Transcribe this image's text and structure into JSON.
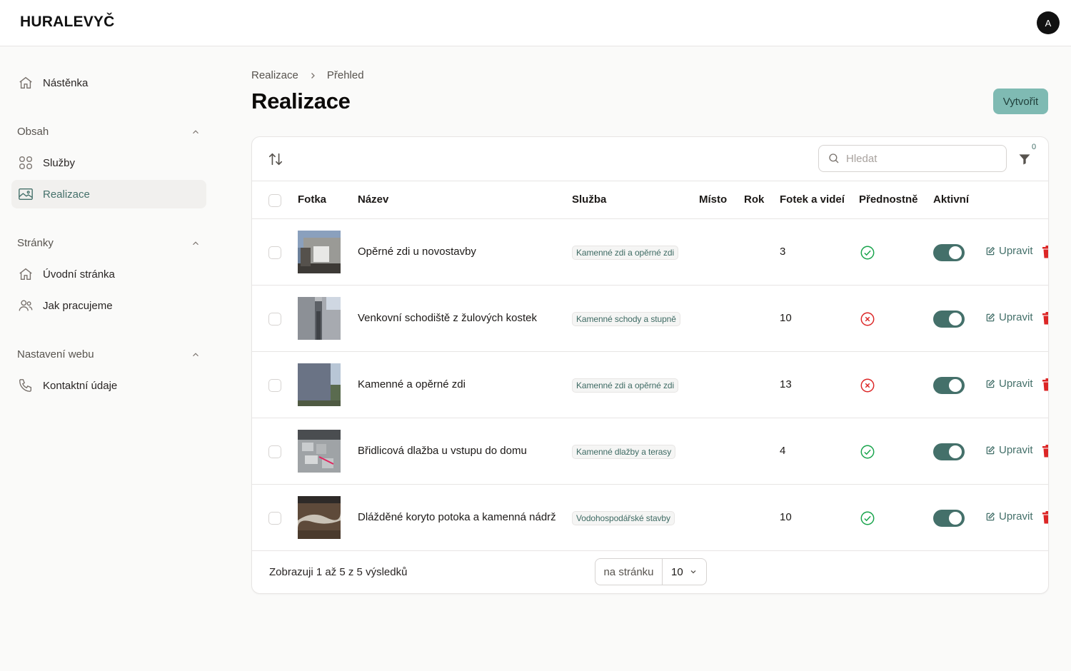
{
  "app": {
    "brand": "HURALEVYČ",
    "avatar_initial": "A"
  },
  "sidebar": {
    "dashboard": {
      "label": "Nástěnka",
      "icon": "home-icon"
    },
    "groups": [
      {
        "title": "Obsah",
        "items": [
          {
            "label": "Služby",
            "icon": "grid-icon",
            "active": false
          },
          {
            "label": "Realizace",
            "icon": "image-icon",
            "active": true
          }
        ]
      },
      {
        "title": "Stránky",
        "items": [
          {
            "label": "Úvodní stránka",
            "icon": "home-icon",
            "active": false
          },
          {
            "label": "Jak pracujeme",
            "icon": "users-icon",
            "active": false
          }
        ]
      },
      {
        "title": "Nastavení webu",
        "items": [
          {
            "label": "Kontaktní údaje",
            "icon": "phone-icon",
            "active": false
          }
        ]
      }
    ]
  },
  "breadcrumb": [
    "Realizace",
    "Přehled"
  ],
  "page": {
    "title": "Realizace",
    "create_label": "Vytvořit"
  },
  "toolbar": {
    "search_placeholder": "Hledat",
    "filter_count": "0"
  },
  "table": {
    "columns": [
      "Fotka",
      "Název",
      "Služba",
      "Místo",
      "Rok",
      "Fotek a videí",
      "Přednostně",
      "Aktivní"
    ],
    "edit_label": "Upravit",
    "rows": [
      {
        "name": "Opěrné zdi u novostavby",
        "service": "Kamenné zdi a opěrné zdi",
        "place": "",
        "year": "",
        "media_count": "3",
        "featured": true,
        "active": true
      },
      {
        "name": "Venkovní schodiště z žulových kostek",
        "service": "Kamenné schody a stupně",
        "place": "",
        "year": "",
        "media_count": "10",
        "featured": false,
        "active": true
      },
      {
        "name": "Kamenné a opěrné zdi",
        "service": "Kamenné zdi a opěrné zdi",
        "place": "",
        "year": "",
        "media_count": "13",
        "featured": false,
        "active": true
      },
      {
        "name": "Břidlicová dlažba u vstupu do domu",
        "service": "Kamenné dlažby a terasy",
        "place": "",
        "year": "",
        "media_count": "4",
        "featured": true,
        "active": true
      },
      {
        "name": "Dlážděné koryto potoka a kamenná nádrž",
        "service": "Vodohospodářské stavby",
        "place": "",
        "year": "",
        "media_count": "10",
        "featured": true,
        "active": true
      }
    ]
  },
  "pagination": {
    "summary": "Zobrazuji 1 až 5 z 5 výsledků",
    "per_page_label": "na stránku",
    "per_page_value": "10"
  },
  "colors": {
    "accent": "#44706a",
    "button": "#7fbab3",
    "success": "#16a34a",
    "danger": "#dc2626"
  }
}
